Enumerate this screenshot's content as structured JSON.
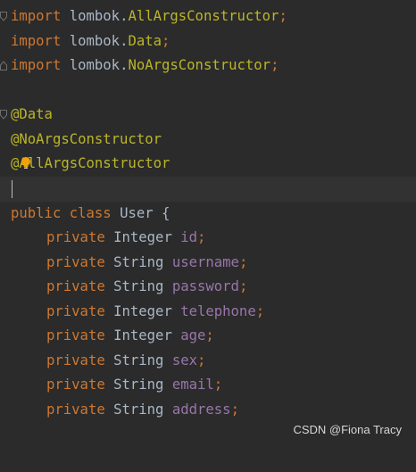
{
  "imports": [
    {
      "keyword": "import",
      "pkg": "lombok.",
      "name": "AllArgsConstructor",
      "semi": ";"
    },
    {
      "keyword": "import",
      "pkg": "lombok.",
      "name": "Data",
      "semi": ";"
    },
    {
      "keyword": "import",
      "pkg": "lombok.",
      "name": "NoArgsConstructor",
      "semi": ";"
    }
  ],
  "annotations": [
    "@Data",
    "@NoArgsConstructor",
    "@AllArgsConstructor"
  ],
  "class_decl": {
    "mods": "public class",
    "name": "User",
    "brace": "{"
  },
  "fields": [
    {
      "mod": "private",
      "type": "Integer",
      "name": "id",
      "semi": ";"
    },
    {
      "mod": "private",
      "type": "String",
      "name": "username",
      "semi": ";"
    },
    {
      "mod": "private",
      "type": "String",
      "name": "password",
      "semi": ";"
    },
    {
      "mod": "private",
      "type": "Integer",
      "name": "telephone",
      "semi": ";"
    },
    {
      "mod": "private",
      "type": "Integer",
      "name": "age",
      "semi": ";"
    },
    {
      "mod": "private",
      "type": "String",
      "name": "sex",
      "semi": ";"
    },
    {
      "mod": "private",
      "type": "String",
      "name": "email",
      "semi": ";"
    },
    {
      "mod": "private",
      "type": "String",
      "name": "address",
      "semi": ";"
    }
  ],
  "watermark": "CSDN @Fiona Tracy",
  "colors": {
    "background": "#2b2b2b",
    "current_line": "#323232",
    "keyword": "#cc7832",
    "annotation": "#bbb529",
    "text": "#a9b7c6",
    "field": "#9876aa"
  }
}
